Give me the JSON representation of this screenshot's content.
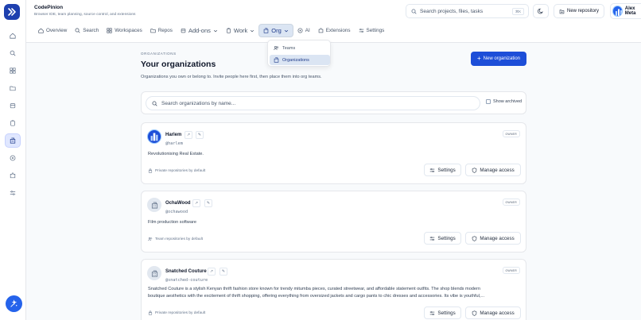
{
  "app": {
    "title": "CodePinion",
    "subtitle": "Browser IDE, team planning, source control, and extensions"
  },
  "header": {
    "search_placeholder": "Search projects, files, tasks",
    "search_shortcut": "⌘K",
    "new_repo_label": "New repository",
    "user_name": "Alex Meta"
  },
  "nav": {
    "items": [
      {
        "label": "Overview",
        "icon": "home-icon"
      },
      {
        "label": "Search",
        "icon": "search-icon"
      },
      {
        "label": "Workspaces",
        "icon": "grid-icon"
      },
      {
        "label": "Repos",
        "icon": "folder-icon"
      },
      {
        "label": "Add-ons",
        "icon": "package-icon"
      },
      {
        "label": "Work",
        "icon": "clipboard-icon"
      },
      {
        "label": "Org",
        "icon": "building-icon"
      },
      {
        "label": "AI",
        "icon": "ai-icon"
      },
      {
        "label": "Extensions",
        "icon": "puzzle-icon"
      },
      {
        "label": "Settings",
        "icon": "sliders-icon"
      }
    ],
    "active": "Org"
  },
  "org_menu": {
    "items": [
      {
        "label": "Teams",
        "icon": "users-icon"
      },
      {
        "label": "Organizations",
        "icon": "building-icon"
      }
    ],
    "active": "Organizations"
  },
  "page": {
    "eyebrow": "ORGANIZATIONS",
    "title": "Your organizations",
    "description": "Organizations you own or belong to. Invite people here first, then place them into org teams.",
    "new_org_label": "New organization"
  },
  "filter": {
    "placeholder": "Search organizations by name...",
    "show_archived_label": "Show archived",
    "show_archived": false
  },
  "orgs": [
    {
      "name": "Harlem",
      "handle": "@harlem",
      "role": "OWNER",
      "description": "Revolutionising Real Estate.",
      "visibility": "Private repositories by default",
      "visibility_icon": "lock-icon",
      "settings_label": "Settings",
      "manage_label": "Manage access"
    },
    {
      "name": "OchaWood",
      "handle": "@ochawood",
      "role": "OWNER",
      "description": "Film production software",
      "visibility": "Team repositories by default",
      "visibility_icon": "users-icon",
      "settings_label": "Settings",
      "manage_label": "Manage access"
    },
    {
      "name": "Snatched Couture",
      "handle": "@snatched-couture",
      "role": "OWNER",
      "description_line1": "Snatched Couture is a stylish Kenyan thrift fashion store known for trendy mitumba pieces, curated streetwear, and affordable statement outfits. The shop blends modern",
      "description_line2": "boutique aesthetics with the excitement of thrift shopping, offering everything from oversized jackets and cargo pants to chic dresses and accessories. Its vibe is youthful,...",
      "visibility": "Private repositories by default",
      "visibility_icon": "lock-icon",
      "settings_label": "Settings",
      "manage_label": "Manage access"
    }
  ],
  "colors": {
    "primary": "#1d4ed8",
    "logo": "#1e40af",
    "active_bg": "#dbe5f3"
  }
}
